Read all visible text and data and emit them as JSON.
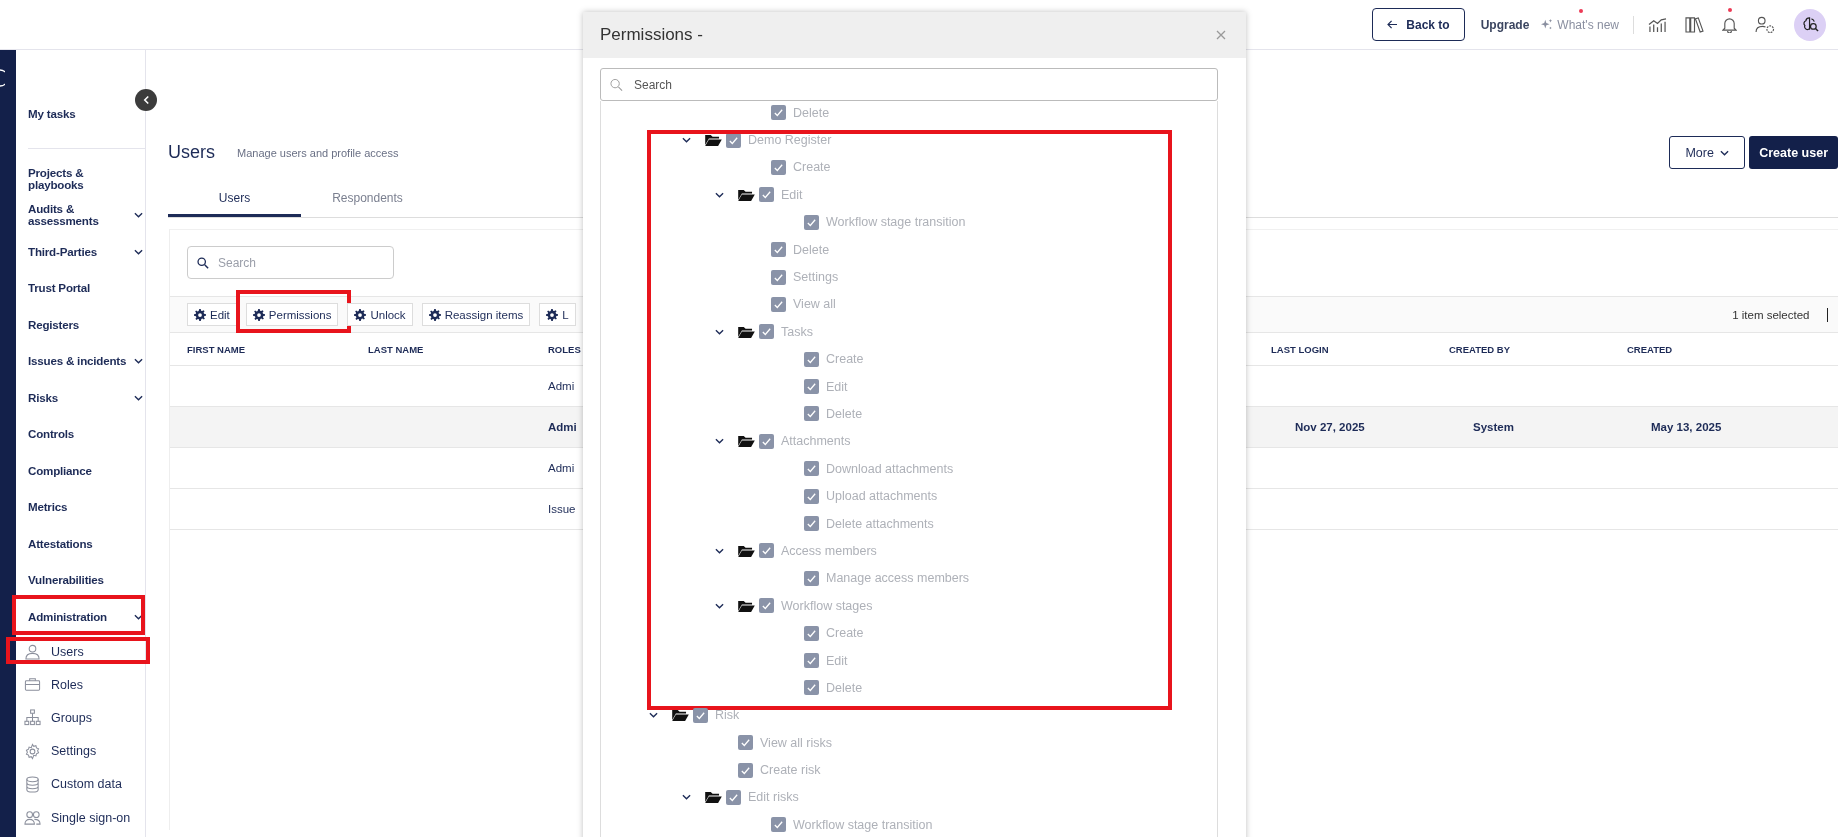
{
  "header": {
    "back_button": "Back to",
    "upgrade": "Upgrade",
    "whats_new": {
      "label": "What's new",
      "unread": true
    },
    "notifications": {
      "unread": true
    }
  },
  "sidebar": {
    "items": [
      {
        "label": "My tasks",
        "kind": "link"
      },
      {
        "label": "Projects & playbooks",
        "kind": "link"
      },
      {
        "label": "Audits & assessments",
        "kind": "group"
      },
      {
        "label": "Third-Parties",
        "kind": "group"
      },
      {
        "label": "Trust Portal",
        "kind": "link"
      },
      {
        "label": "Registers",
        "kind": "link"
      },
      {
        "label": "Issues & incidents",
        "kind": "group"
      },
      {
        "label": "Risks",
        "kind": "group"
      },
      {
        "label": "Controls",
        "kind": "link"
      },
      {
        "label": "Compliance",
        "kind": "link"
      },
      {
        "label": "Metrics",
        "kind": "link"
      },
      {
        "label": "Attestations",
        "kind": "link"
      },
      {
        "label": "Vulnerabilities",
        "kind": "link"
      },
      {
        "label": "Administration",
        "kind": "group",
        "highlighted": true,
        "children": [
          {
            "label": "Users",
            "highlighted": true
          },
          {
            "label": "Roles",
            "highlighted": false
          },
          {
            "label": "Groups",
            "highlighted": false
          },
          {
            "label": "Settings",
            "highlighted": false
          },
          {
            "label": "Custom data",
            "highlighted": false
          },
          {
            "label": "Single sign-on",
            "highlighted": false
          }
        ]
      }
    ]
  },
  "page": {
    "title": "Users",
    "subtitle": "Manage users and profile access",
    "more_button": "More",
    "create_button": "Create user"
  },
  "tabs": [
    {
      "label": "Users",
      "selected": true
    },
    {
      "label": "Respondents",
      "selected": false
    }
  ],
  "search": {
    "placeholder": "Search"
  },
  "toolbar": {
    "buttons": [
      {
        "label": "Edit",
        "highlighted": false
      },
      {
        "label": "Permissions",
        "highlighted": true
      },
      {
        "label": "Unlock",
        "highlighted": false
      },
      {
        "label": "Reassign items",
        "highlighted": false
      },
      {
        "label": "L",
        "highlighted": false
      }
    ],
    "selection": "1 item selected"
  },
  "table": {
    "columns": [
      "FIRST NAME",
      "LAST NAME",
      "ROLES",
      "LAST LOGIN",
      "CREATED BY",
      "CREATED"
    ],
    "rows": [
      {
        "roles": "Admi",
        "selected": false
      },
      {
        "roles": "Admi",
        "last_login": "Nov 27, 2025",
        "created_by": "System",
        "created": "May 13, 2025",
        "selected": true
      },
      {
        "roles": "Admi",
        "selected": false
      },
      {
        "roles": "Issue",
        "selected": false
      }
    ]
  },
  "dialog": {
    "title": "Permissions -",
    "search": {
      "placeholder": "Search"
    },
    "disabled": true,
    "tree": [
      {
        "children": [
          {
            "children": [
              {
                "label": "Delete",
                "checked": true
              }
            ]
          },
          {
            "label": "Demo Register",
            "checked": true,
            "expanded": true,
            "highlighted": true,
            "children": [
              {
                "label": "Create",
                "checked": true
              },
              {
                "label": "Edit",
                "checked": true,
                "expanded": true,
                "children": [
                  {
                    "label": "Workflow stage transition",
                    "checked": true
                  }
                ]
              },
              {
                "label": "Delete",
                "checked": true
              },
              {
                "label": "Settings",
                "checked": true
              },
              {
                "label": "View all",
                "checked": true
              },
              {
                "label": "Tasks",
                "checked": true,
                "expanded": true,
                "children": [
                  {
                    "label": "Create",
                    "checked": true
                  },
                  {
                    "label": "Edit",
                    "checked": true
                  },
                  {
                    "label": "Delete",
                    "checked": true
                  }
                ]
              },
              {
                "label": "Attachments",
                "checked": true,
                "expanded": true,
                "children": [
                  {
                    "label": "Download attachments",
                    "checked": true
                  },
                  {
                    "label": "Upload attachments",
                    "checked": true
                  },
                  {
                    "label": "Delete attachments",
                    "checked": true
                  }
                ]
              },
              {
                "label": "Access members",
                "checked": true,
                "expanded": true,
                "children": [
                  {
                    "label": "Manage access members",
                    "checked": true
                  }
                ]
              },
              {
                "label": "Workflow stages",
                "checked": true,
                "expanded": true,
                "children": [
                  {
                    "label": "Create",
                    "checked": true
                  },
                  {
                    "label": "Edit",
                    "checked": true
                  },
                  {
                    "label": "Delete",
                    "checked": true
                  }
                ]
              }
            ]
          }
        ]
      },
      {
        "label": "Risk",
        "checked": true,
        "expanded": true,
        "children": [
          {
            "label": "View all risks",
            "checked": true
          },
          {
            "label": "Create risk",
            "checked": true
          },
          {
            "label": "Edit risks",
            "checked": true,
            "expanded": true,
            "children": [
              {
                "label": "Workflow stage transition",
                "checked": true
              }
            ]
          }
        ]
      }
    ]
  }
}
